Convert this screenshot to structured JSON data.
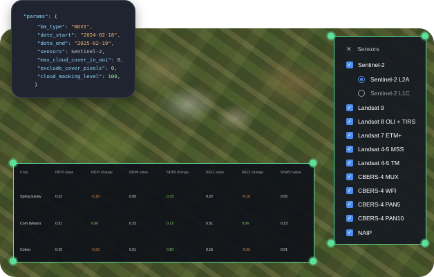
{
  "code_panel": {
    "lines": [
      [
        "\"params\"",
        ": {",
        ""
      ],
      [
        "\"bm_type\"",
        ": ",
        "\"NDVI\","
      ],
      [
        "\"date_start\"",
        ": ",
        "\"2024-02-18\","
      ],
      [
        "\"date_end\"",
        ": ",
        "\"2025-02-19\","
      ],
      [
        "\"sensors\"",
        ": ",
        "Sentinel-2,"
      ],
      [
        "\"max_cloud_cover_in_aoi\"",
        ": ",
        "0,"
      ],
      [
        "\"exclude_cover_pixels\"",
        ": ",
        "0,"
      ],
      [
        "\"cloud_masking_level\"",
        ": ",
        "100,"
      ],
      [
        "}",
        "",
        ""
      ]
    ]
  },
  "sensors": {
    "title": "Sensors",
    "items": [
      {
        "label": "Sentinel-2",
        "type": "checkbox",
        "checked": true
      },
      {
        "label": "Sentinel-2 L2A",
        "type": "radio",
        "checked": true
      },
      {
        "label": "Sentinel-2 L1C",
        "type": "radio",
        "checked": false
      },
      {
        "label": "Landsat 9",
        "type": "checkbox",
        "checked": true
      },
      {
        "label": "Landsat 8 OLI + TIRS",
        "type": "checkbox",
        "checked": true
      },
      {
        "label": "Landsat 7 ETM+",
        "type": "checkbox",
        "checked": true
      },
      {
        "label": "Landsat 4-5 MSS",
        "type": "checkbox",
        "checked": true
      },
      {
        "label": "Landsat 4-5 TM",
        "type": "checkbox",
        "checked": true
      },
      {
        "label": "CBERS-4 MUX",
        "type": "checkbox",
        "checked": true
      },
      {
        "label": "CBERS-4 WFI",
        "type": "checkbox",
        "checked": true
      },
      {
        "label": "CBERS-4 PAN5",
        "type": "checkbox",
        "checked": true
      },
      {
        "label": "CBERS-4 PAN10",
        "type": "checkbox",
        "checked": true
      },
      {
        "label": "NAIP",
        "type": "checkbox",
        "checked": true
      }
    ]
  },
  "table": {
    "headers": [
      "Crop",
      "NDVI value",
      "NDVI change",
      "NDMI value",
      "NDMI change",
      "RECI value",
      "RECI change",
      "MSAVI value"
    ],
    "rows": [
      [
        "Spring barley",
        "0.22",
        "-0.18",
        "0.05",
        "0.33",
        "0.22",
        "-0.10",
        "0.05"
      ],
      [
        "Corn (Maize)",
        "0.51",
        "0.06",
        "0.23",
        "0.12",
        "0.51",
        "0.06",
        "0.23"
      ],
      [
        "Cotton",
        "0.15",
        "-0.33",
        "0.01",
        "0.80",
        "0.15",
        "-0.32",
        "0.01"
      ]
    ]
  },
  "colors": {
    "accent": "#5de19a",
    "checkbox": "#4d8ff0",
    "positive": "#7fd36b",
    "negative": "#e8904a"
  }
}
